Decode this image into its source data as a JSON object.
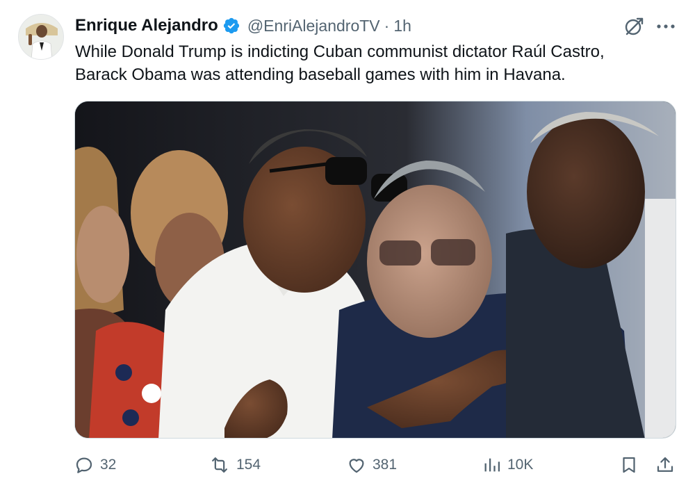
{
  "author": {
    "name": "Enrique Alejandro",
    "handle": "@EnriAlejandroTV",
    "separator": "·",
    "time": "1h",
    "verified": true
  },
  "tweet": {
    "lines": [
      "While Donald Trump is indicting Cuban communist dictator Raúl Castro,",
      "Barack Obama was attending baseball games with him in Havana."
    ]
  },
  "actions": {
    "replies": "32",
    "reposts": "154",
    "likes": "381",
    "views": "10K"
  },
  "colors": {
    "verified_blue": "#1d9bf0",
    "secondary_text": "#536471",
    "primary_text": "#0f1419"
  },
  "icons": [
    "grok-icon",
    "more-icon",
    "reply-icon",
    "repost-icon",
    "like-icon",
    "views-icon",
    "bookmark-icon",
    "share-icon"
  ]
}
